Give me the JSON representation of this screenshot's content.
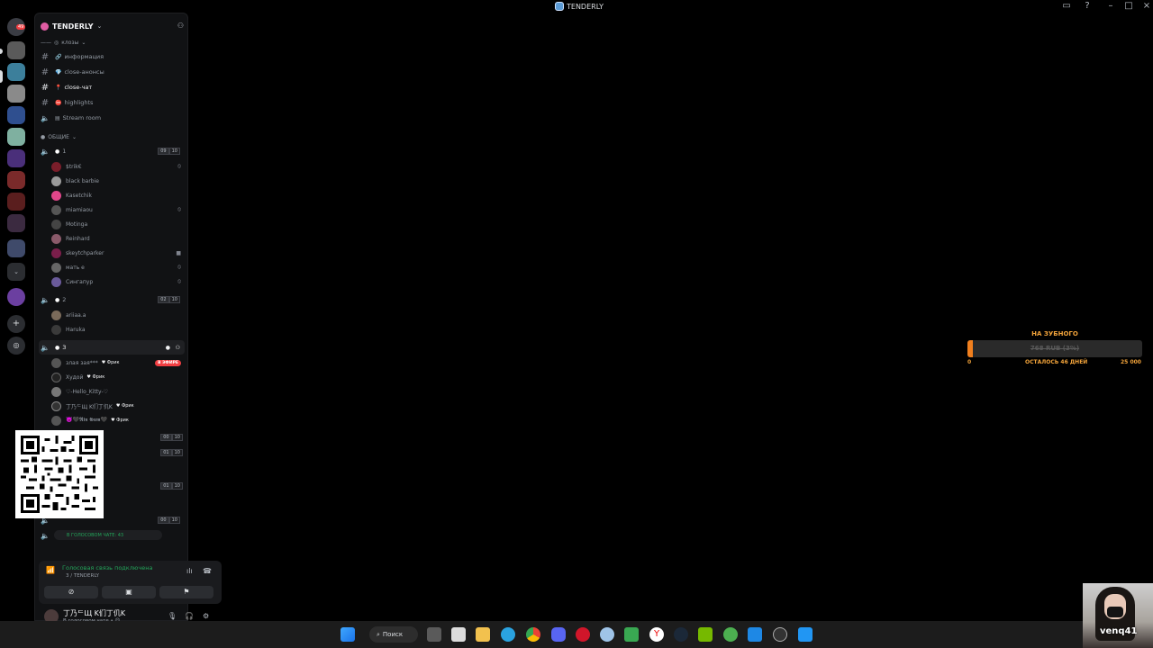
{
  "window": {
    "title": "TENDERLY"
  },
  "server": {
    "name": "TENDERLY"
  },
  "categories": {
    "closed": "клозы",
    "common": "ОБЩИЕ"
  },
  "channels": [
    {
      "name": "информация",
      "type": "text"
    },
    {
      "name": "close-анонсы",
      "type": "text"
    },
    {
      "name": "close-чат",
      "type": "text"
    },
    {
      "name": "highlights",
      "type": "text"
    },
    {
      "name": "Stream room",
      "type": "voice"
    }
  ],
  "voice_channels": [
    {
      "name": "1",
      "count_a": "09",
      "count_b": "10",
      "users": [
        "$trik€",
        "black barbie",
        "Kasetchik",
        "miamiaou",
        "Motinga",
        "Reinhard",
        "skeytchparker",
        "мать е",
        "Сингапур"
      ]
    },
    {
      "name": "2",
      "count_a": "02",
      "count_b": "10",
      "users": [
        "ariiaa.a",
        "Haruka"
      ]
    },
    {
      "name": "3",
      "users": [
        "злая зая***",
        "Худой",
        "♡-Hello_Kitty-♡",
        "丁乃ᄃЩ K们丁仉K",
        "👿‍🖤𝕽𝖎𝖓 𝕲𝖚𝖒🖤"
      ],
      "tags": [
        "Фрик",
        "Фрик",
        "",
        "Фрик",
        "Фрик"
      ],
      "live_label": "В ЭФИРЕ"
    }
  ],
  "extra_counts": [
    {
      "a": "00",
      "b": "10"
    },
    {
      "a": "01",
      "b": "10"
    },
    {
      "a": "01",
      "b": "10"
    },
    {
      "a": "00",
      "b": "10"
    }
  ],
  "voice_chip": "В ГОЛОСОВОМ ЧАТЕ: 43",
  "voice_panel": {
    "status": "Голосовая связь подключена",
    "location": "3 / TENDERLY"
  },
  "user_panel": {
    "name": "丁乃ᄃЩ K们丁仉K",
    "status": "В голосовом чате • 😊"
  },
  "donation": {
    "title": "НА ЗУБНОГО",
    "bar_text": "768 RUB (3%)",
    "progress_percent": 3,
    "min": "0",
    "remaining": "ОСТАЛОСЬ 46 ДНЕЙ",
    "max": "25 000"
  },
  "taskbar": {
    "search_label": "Поиск"
  },
  "webcam": {
    "name": "venq41"
  },
  "colors": {
    "accent_orange": "#f07f1e",
    "voice_green": "#23a55a",
    "live_red": "#f23f43",
    "sidebar_bg": "#111214"
  }
}
